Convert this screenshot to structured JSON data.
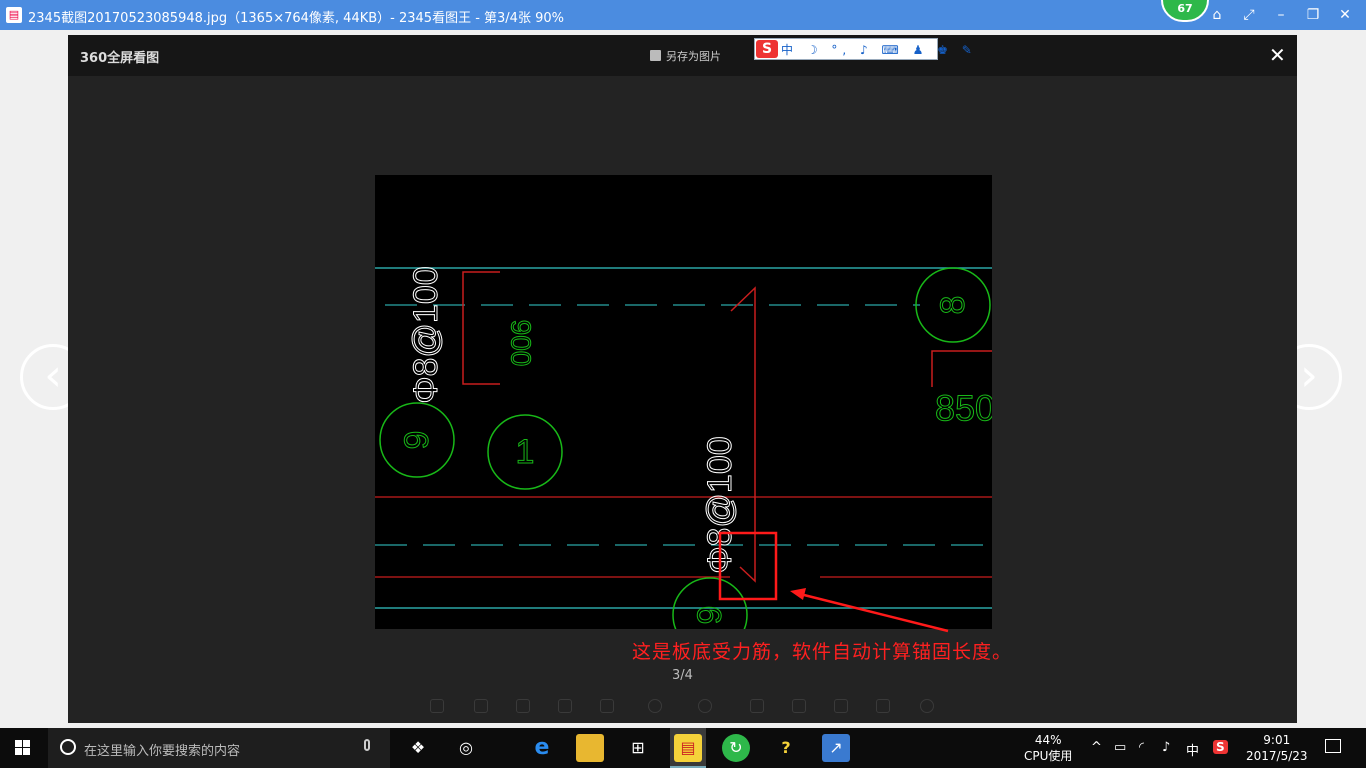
{
  "window": {
    "title": "2345截图20170523085948.jpg（1365×764像素, 44KB）- 2345看图王 - 第3/4张 90%",
    "badge": "67"
  },
  "viewer": {
    "logo_text": "360全屏看图",
    "save_label": "另存为图片",
    "ime_items": "中 ☽ °, ♪ ⌨ ♟ ♚ ✎",
    "annotation": "这是板底受力筋，软件自动计算锚固长度。",
    "page_indicator": "3/4"
  },
  "drawing": {
    "rebar_left": "Φ8@100",
    "dim_left": "900",
    "rebar_mid": "Φ8@100",
    "dim_right": "850",
    "axis_9_top": "9",
    "axis_1": "1",
    "axis_8": "8",
    "axis_9_bottom": "9"
  },
  "taskbar": {
    "search_placeholder": "在这里输入你要搜索的内容",
    "cpu_percent": "44%",
    "cpu_label": "CPU使用",
    "ime_indicator": "中",
    "time": "9:01",
    "date": "2017/5/23"
  },
  "colors": {
    "titlebar": "#4b8ce0",
    "cyan_line": "#2aa6a6",
    "red_line": "#c81e1e",
    "green_drawing": "#18b818",
    "annotation": "#ff2020"
  }
}
